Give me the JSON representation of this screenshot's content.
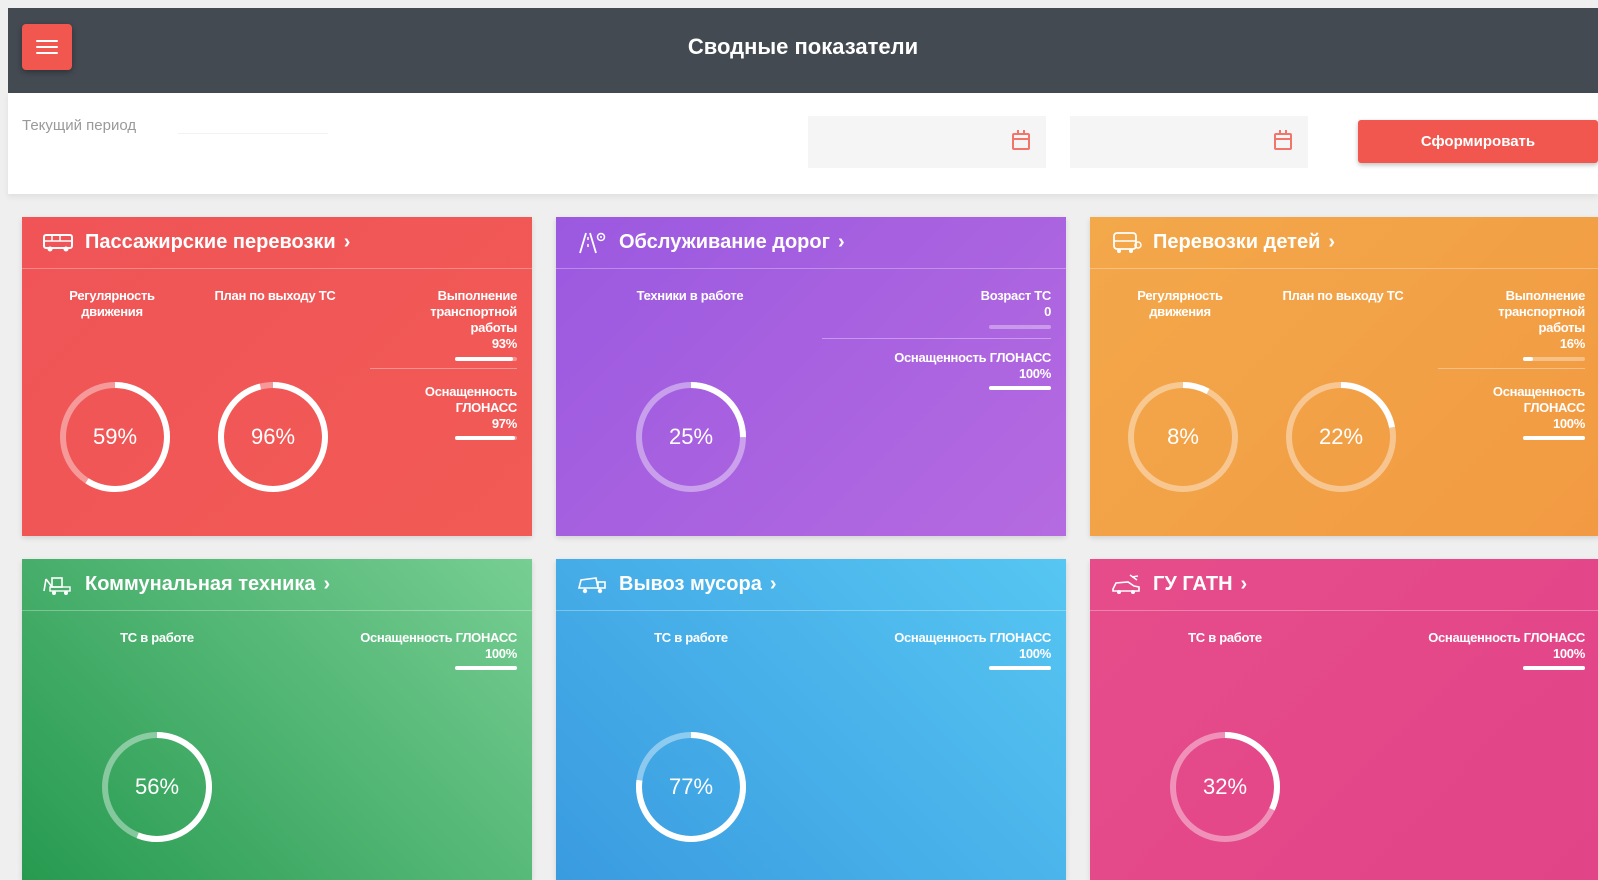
{
  "header": {
    "title": "Сводные показатели"
  },
  "filters": {
    "period_label": "Текущий период",
    "submit_label": "Сформировать"
  },
  "colors": {
    "accent": "#f1574e",
    "topbar": "#444a52",
    "passenger": "#f05457",
    "roads": "#a55ee0",
    "children": "#f3a548",
    "communal": "#4fb873",
    "garbage": "#47b2eb",
    "gatn": "#e24886"
  },
  "cards": {
    "passenger": {
      "title": "Пассажирские перевозки",
      "icon": "bus-icon",
      "m1_label": "Регулярность движения",
      "m1_pct": 59,
      "m1_text": "59%",
      "m2_label": "План по выходу ТС",
      "m2_pct": 96,
      "m2_text": "96%",
      "s1_label": "Выполнение транспортной работы",
      "s1_value": "93%",
      "s1_pct": 93,
      "s2_label": "Оснащенность ГЛОНАСС",
      "s2_value": "97%",
      "s2_pct": 97
    },
    "roads": {
      "title": "Обслуживание дорог",
      "icon": "road-icon",
      "m1_label": "Техники в работе",
      "m1_pct": 25,
      "m1_text": "25%",
      "s1_label": "Возраст ТС",
      "s1_value": "0",
      "s1_pct": 0,
      "s2_label": "Оснащенность ГЛОНАСС",
      "s2_value": "100%",
      "s2_pct": 100
    },
    "children": {
      "title": "Перевозки детей",
      "icon": "school-bus-icon",
      "m1_label": "Регулярность движения",
      "m1_pct": 8,
      "m1_text": "8%",
      "m2_label": "План по выходу ТС",
      "m2_pct": 22,
      "m2_text": "22%",
      "s1_label": "Выполнение транспортной работы",
      "s1_value": "16%",
      "s1_pct": 16,
      "s2_label": "Оснащенность ГЛОНАСС",
      "s2_value": "100%",
      "s2_pct": 100
    },
    "communal": {
      "title": "Коммунальная техника",
      "icon": "tractor-icon",
      "m1_label": "ТС в работе",
      "m1_pct": 56,
      "m1_text": "56%",
      "s1_label": "Оснащенность ГЛОНАСС",
      "s1_value": "100%",
      "s1_pct": 100
    },
    "garbage": {
      "title": "Вывоз мусора",
      "icon": "garbage-truck-icon",
      "m1_label": "ТС в работе",
      "m1_pct": 77,
      "m1_text": "77%",
      "s1_label": "Оснащенность ГЛОНАСС",
      "s1_value": "100%",
      "s1_pct": 100
    },
    "gatn": {
      "title": "ГУ ГАТН",
      "icon": "inspection-car-icon",
      "m1_label": "ТС в работе",
      "m1_pct": 32,
      "m1_text": "32%",
      "s1_label": "Оснащенность ГЛОНАСС",
      "s1_value": "100%",
      "s1_pct": 100
    }
  }
}
